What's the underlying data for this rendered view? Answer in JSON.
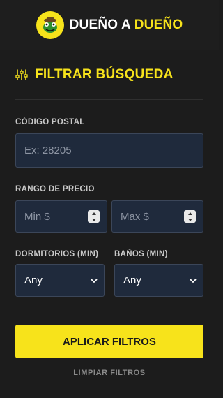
{
  "header": {
    "brand_part1": "DUEÑO A",
    "brand_part2": "DUEÑO",
    "logo_icon": "frog-logo-icon",
    "accent_color": "#f7e31b"
  },
  "filters": {
    "title": "FILTRAR BÚSQUEDA",
    "title_icon": "sliders-icon",
    "postal": {
      "label": "CÓDIGO POSTAL",
      "placeholder": "Ex: 28205",
      "value": ""
    },
    "price": {
      "label": "RANGO DE PRECIO",
      "min_placeholder": "Min $",
      "max_placeholder": "Max $"
    },
    "bedrooms": {
      "label": "DORMITORIOS (MIN)",
      "value": "Any"
    },
    "bathrooms": {
      "label": "BAÑOS (MIN)",
      "value": "Any"
    },
    "apply_label": "APLICAR FILTROS",
    "clear_label": "LIMPIAR FILTROS"
  }
}
